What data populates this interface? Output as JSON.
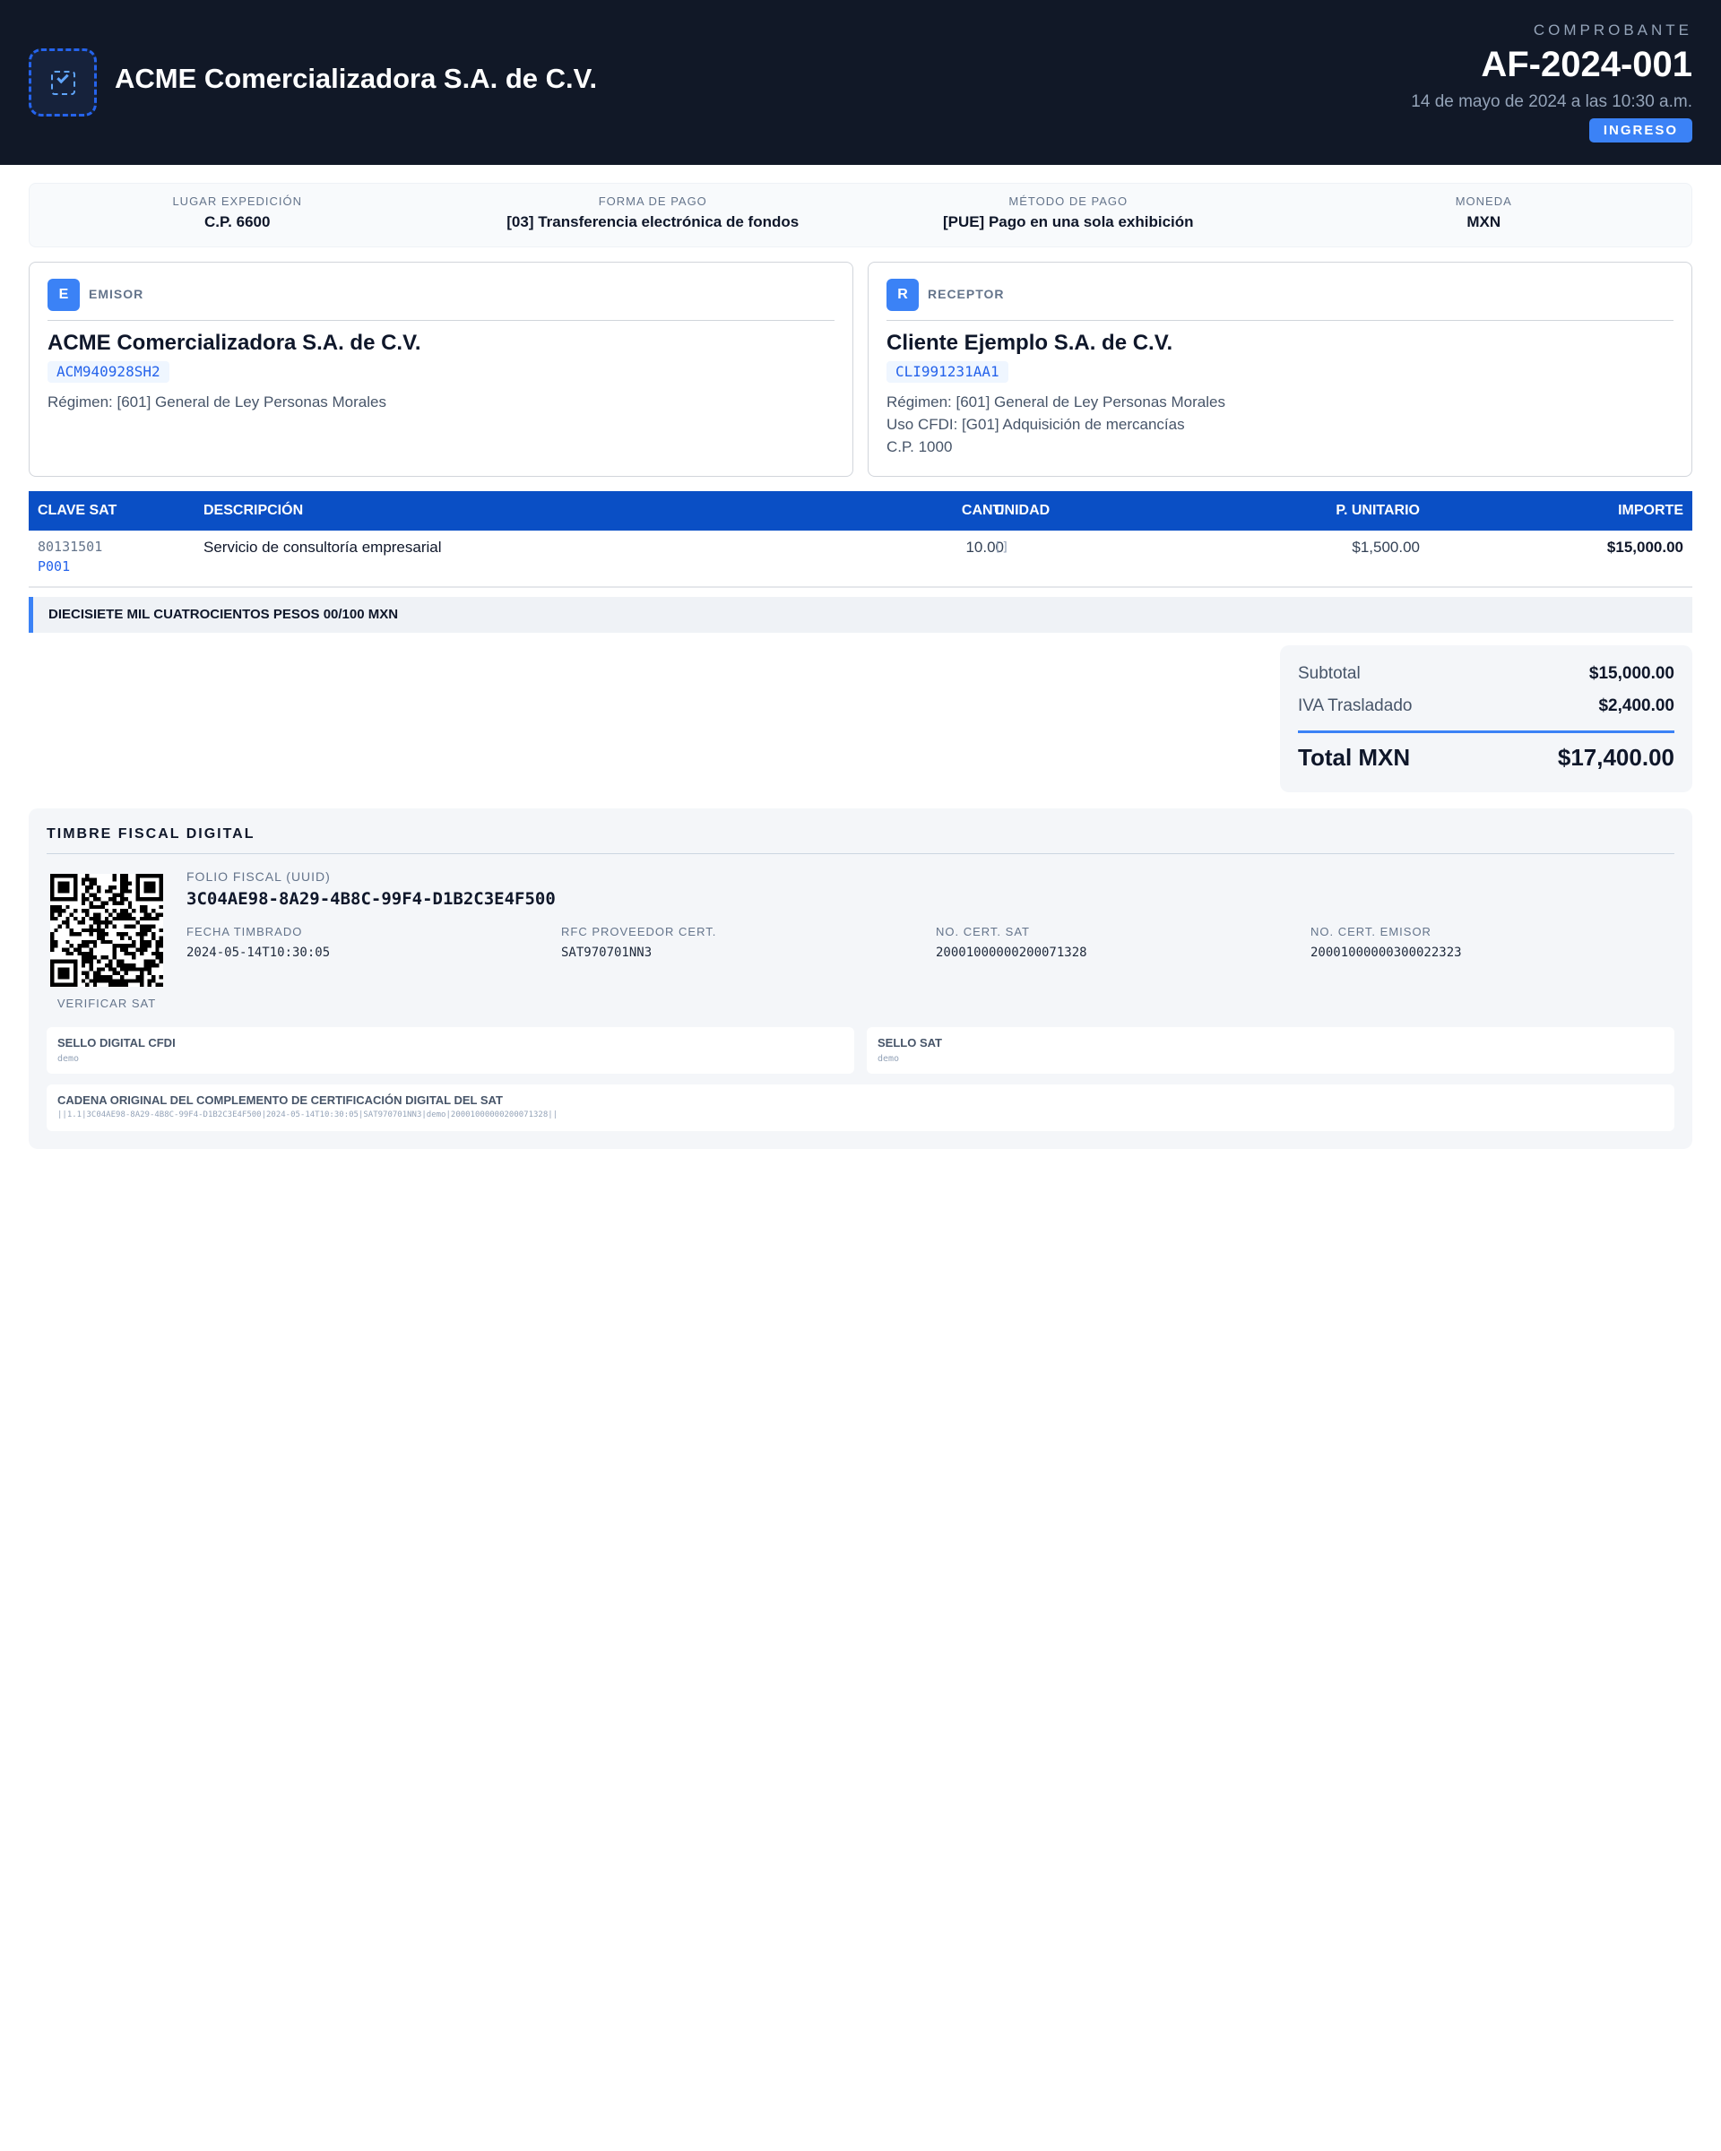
{
  "header": {
    "company_name": "ACME Comercializadora S.A. de C.V.",
    "logo_icon": "image-icon",
    "doc_label": "COMPROBANTE",
    "folio": "AF-2024-001",
    "fecha": "14 de mayo de 2024 a las 10:30 a.m.",
    "tipo": "INGRESO"
  },
  "meta": [
    {
      "label": "LUGAR EXPEDICIÓN",
      "value": "C.P. 6600"
    },
    {
      "label": "FORMA DE PAGO",
      "value": "[03] Transferencia electrónica de fondos"
    },
    {
      "label": "MÉTODO DE PAGO",
      "value": "[PUE] Pago en una sola exhibición"
    },
    {
      "label": "MONEDA",
      "value": "MXN"
    }
  ],
  "emisor": {
    "badge": "E",
    "role": "EMISOR",
    "name": "ACME Comercializadora S.A. de C.V.",
    "rfc": "ACM940928SH2",
    "regimen": "Régimen: [601] General de Ley Personas Morales"
  },
  "receptor": {
    "badge": "R",
    "role": "RECEPTOR",
    "name": "Cliente Ejemplo S.A. de C.V.",
    "rfc": "CLI991231AA1",
    "regimen": "Régimen: [601] General de Ley Personas Morales",
    "uso_cfdi": "Uso CFDI: [G01] Adquisición de mercancías",
    "cp": "C.P. 1000"
  },
  "items": {
    "headers": {
      "clave": "CLAVE SAT",
      "descripcion": "DESCRIPCIÓN",
      "cantidad": "CANT.",
      "unidad": "UNIDAD",
      "unitario": "P. UNITARIO",
      "importe": "IMPORTE"
    },
    "rows": [
      {
        "clave": "80131501",
        "clave_unidad": "P001",
        "descripcion": "Servicio de consultoría empresarial",
        "cantidad": "10.00",
        "unidad": "[]",
        "unitario": "$1,500.00",
        "importe": "$15,000.00"
      }
    ]
  },
  "importe_letra": "DIECISIETE MIL CUATROCIENTOS PESOS 00/100 MXN",
  "totales": {
    "subtotal_label": "Subtotal",
    "subtotal": "$15,000.00",
    "iva_label": "IVA Trasladado",
    "iva": "$2,400.00",
    "total_label": "Total MXN",
    "total": "$17,400.00"
  },
  "timbre": {
    "title": "TIMBRE FISCAL DIGITAL",
    "qr_icon": "qr-code-icon",
    "qr_caption": "VERIFICAR SAT",
    "uuid_label": "FOLIO FISCAL (UUID)",
    "uuid": "3C04AE98-8A29-4B8C-99F4-D1B2C3E4F500",
    "fecha_label": "FECHA TIMBRADO",
    "fecha": "2024-05-14T10:30:05",
    "rfc_prov_label": "RFC PROVEEDOR CERT.",
    "rfc_prov": "SAT970701NN3",
    "cert_sat_label": "NO. CERT. SAT",
    "cert_sat": "20001000000200071328",
    "cert_emisor_label": "NO. CERT. EMISOR",
    "cert_emisor": "20001000000300022323",
    "sello_cfdi_label": "SELLO DIGITAL CFDI",
    "sello_cfdi": "demo",
    "sello_sat_label": "SELLO SAT",
    "sello_sat": "demo",
    "cadena_label": "CADENA ORIGINAL DEL COMPLEMENTO DE CERTIFICACIÓN DIGITAL DEL SAT",
    "cadena": "||1.1|3C04AE98-8A29-4B8C-99F4-D1B2C3E4F500|2024-05-14T10:30:05|SAT970701NN3|demo|20001000000200071328||"
  },
  "colors": {
    "header_bg": "#111827",
    "accent": "#3b82f6",
    "table_header": "#0a4fc5"
  }
}
